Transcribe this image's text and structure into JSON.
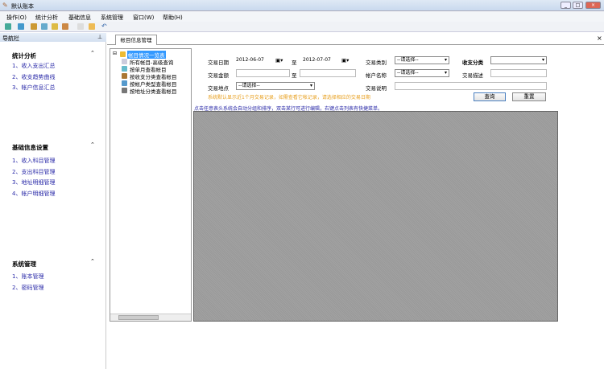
{
  "window": {
    "title": "默认账本",
    "controls": [
      "_",
      "□",
      "×"
    ]
  },
  "menu": [
    "操作(O)",
    "统计分析",
    "基础信息",
    "系统管理",
    "窗口(W)",
    "帮助(H)"
  ],
  "toolbar": {
    "icons": [
      "mail-icon",
      "chart-icon",
      "box-icon",
      "email-icon",
      "home-icon",
      "package-icon",
      "doc-icon",
      "folder-icon",
      "undo-icon"
    ]
  },
  "nav": {
    "title": "导航栏",
    "pin": "ᵖ",
    "sections": [
      {
        "title": "统计分析",
        "items": [
          "1、收入支出汇总",
          "2、收支趋势曲线",
          "3、帐户信息汇总"
        ]
      },
      {
        "title": "基础信息设置",
        "items": [
          "1、收入科目管理",
          "2、支出科目管理",
          "3、地址明细管理",
          "4、帐户明细管理"
        ]
      },
      {
        "title": "系统管理",
        "items": [
          "1、账本管理",
          "2、密码管理"
        ]
      }
    ]
  },
  "tab": {
    "label": "帐目信息管理",
    "close": "×"
  },
  "tree": {
    "root": "帐目情况一览表",
    "items": [
      "所有帐目-高级查询",
      "按单月查看帐目",
      "按收支分类查看帐目",
      "按帐户类型查看帐目",
      "按地址分类查看帐目"
    ]
  },
  "form": {
    "date_label": "交易日期",
    "date_from": "2012-06-07",
    "to": "至",
    "date_to": "2012-07-07",
    "amount_label": "交易金额",
    "amount_from": "",
    "amount_to": "",
    "place_label": "交易地点",
    "place_value": "--请选择--",
    "type_label": "交易类别",
    "type_value": "--请选择--",
    "category_label": "收支分类",
    "category_value": "",
    "account_label": "帐户名称",
    "account_value": "--请选择--",
    "desc_label": "交易描述",
    "desc_value": "",
    "note_label": "交易说明",
    "note_value": "",
    "query": "查询",
    "reset": "重置",
    "hint": "系统默认显示近1个月交易记录，如需查看它帐记录，请选择相应的交易日期",
    "tip": "点击任意表头系统会自动分组和排序，双击某行可进行编辑，右键点击列表有快捷菜单。"
  },
  "colors": {
    "hint": "#e8a020",
    "link": "#2a2aa8",
    "grid": "#9a9a9a"
  }
}
